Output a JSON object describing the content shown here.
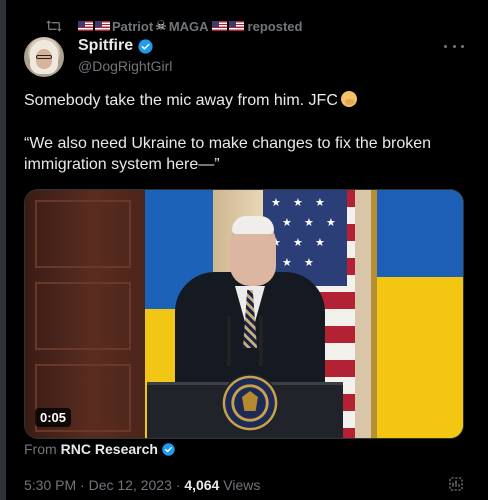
{
  "repost": {
    "text": "Patriot",
    "text2": "MAGA",
    "suffix": "reposted"
  },
  "post": {
    "name": "Spitfire",
    "handle": "@DogRightGirl",
    "text1": "Somebody take the mic away from him. JFC",
    "text2": "“We also need Ukraine to make changes to fix the broken immigration system here—”",
    "media_time": "0:05",
    "from_label": "From",
    "from_name": "RNC Research",
    "timestamp": "5:30 PM · Dec 12, 2023 · ",
    "views_count": "4,064",
    "views_label": " Views"
  },
  "icons": {
    "repost": "repost-icon",
    "verified": "verified-badge-icon",
    "more": "more-options-icon",
    "analytics": "analytics-icon",
    "facepalm": "face-palm-icon"
  },
  "colors": {
    "accent": "#1d9bf0",
    "secondary_text": "#71767b",
    "primary_text": "#e7e9ea",
    "background": "#000000"
  }
}
